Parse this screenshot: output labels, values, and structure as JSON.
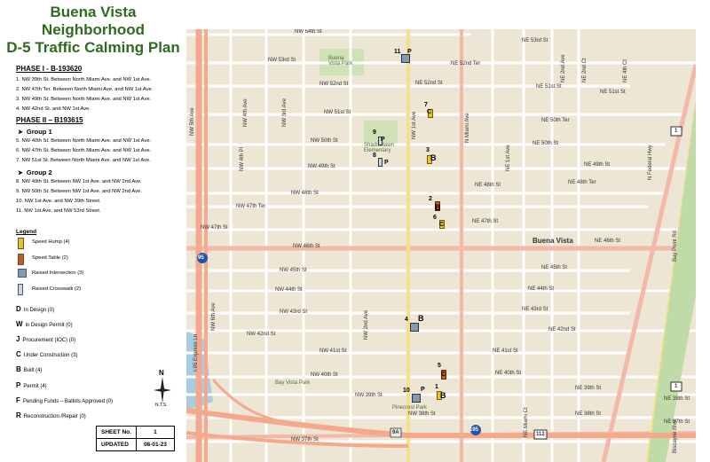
{
  "title": {
    "line1": "Buena Vista",
    "line2": "Neighborhood",
    "line3": "D-5 Traffic Calming Plan"
  },
  "phase1": {
    "heading": "PHASE I - B-193620",
    "items": [
      "1.   NW 39th St. Between North Miami Ave. and NW 1st Ave.",
      "2.   NW 47th Ter. Between North Miami Ave. and NW 1st Ave.",
      "3.   NW 49th St. Between North Miami Ave. and NW 1st Ave.",
      "4.   NW 42nd St. and NW 1st Ave."
    ]
  },
  "phase2": {
    "heading": "PHASE II – B193615",
    "group1": {
      "label": "Group 1",
      "items": [
        "5.   NW 40th St. Between North Miami Ave. and NW 1st Ave.",
        "6.   NW 47th St. Between North Miami Ave. and NW 1st Ave.",
        "7.   NW 51st St. Between North Miami Ave. and NW 1st Ave."
      ]
    },
    "group2": {
      "label": "Group 2",
      "items": [
        "8.   NW 49th St. Between NW 1st Ave. and NW 2nd Ave.",
        "9.   NW 50th St. Between NW 1st Ave. and NW 2nd Ave.",
        "10.  NW 1st Ave. and NW 39th Street.",
        "11.  NW 1st Ave. and NW 53rd Street."
      ]
    }
  },
  "legend": {
    "heading": "Legend",
    "entries": [
      {
        "label": "Speed Hump (4)",
        "color": "#e9c21f"
      },
      {
        "label": "Speed Table (2)",
        "color": "#c85a12"
      },
      {
        "label": "Raised Intersection (3)",
        "color": "#7f9bb5"
      },
      {
        "label": "Raised Crosswalk (2)",
        "color": "#c8d6ea"
      }
    ]
  },
  "status": [
    {
      "code": "D",
      "label": "In Design  (0)"
    },
    {
      "code": "W",
      "label": "in Design Permit  (0)"
    },
    {
      "code": "J",
      "label": "Procurement (IOC)  (0)"
    },
    {
      "code": "C",
      "label": "Under Construction   (3)"
    },
    {
      "code": "B",
      "label": "Built   (4)"
    },
    {
      "code": "P",
      "label": "Permit   (4)"
    },
    {
      "code": "F",
      "label": "Pending Funds – Ballots Approved (0)"
    },
    {
      "code": "R",
      "label": "Reconstruction /Repair (0)"
    }
  ],
  "north": {
    "letter": "N",
    "note": "N.T.S."
  },
  "sheet": {
    "label1": "SHEET No.",
    "value1": "1",
    "label2": "UPDATED",
    "value2": "08-01-23"
  },
  "map": {
    "area_label": "Buena Vista",
    "park1": "Buena Vista Park",
    "park2": "Bay Vista Park",
    "school": "Shadowlawn Elementary",
    "park3": "Pinecrest Park",
    "streets": [
      "NW 54th St",
      "NW 53rd St",
      "NW 52nd St",
      "NW 51st St",
      "NW 50th St",
      "NW 49th St",
      "NW 48th St",
      "NW 47th Ter",
      "NW 47th St",
      "NW 46th St",
      "NW 45th St",
      "NW 44th St",
      "NW 43rd St",
      "NW 42nd St",
      "NW 41st St",
      "NW 40th St",
      "NW 39th St",
      "NW 38th St",
      "NW 37th St",
      "NE 53rd St",
      "NE 52nd Ter",
      "NE 52nd St",
      "NE 51st St",
      "NE 50th Ter",
      "NE 50th St",
      "NE 49th St",
      "NE 48th St",
      "NE 47th St",
      "NE 46th St",
      "NE 45th St",
      "NE 44th St",
      "NE 43rd St",
      "NE 42nd St",
      "NE 41st St",
      "NE 40th St",
      "NE 39th St",
      "NE 38th St",
      "NE 37th St",
      "NE 48th Ter",
      "NE 51st St",
      "NE 38th St"
    ],
    "avenues": [
      "NW 5th Ave",
      "NW 4th Pl",
      "NW 4th Ave",
      "NW 3rd Ave",
      "NW 2nd Ave",
      "NW 1st Ave",
      "N Miami Ave",
      "NE 1st Ave",
      "NE 2nd Ave",
      "NE 2nd Ct",
      "NE 4th Ct",
      "N Federal Hwy",
      "Biscayne Blvd",
      "Bay Point Rd",
      "I-95 Express Ln",
      "NW 6th Ave",
      "NE Miami Ct"
    ],
    "shields": [
      "1",
      "95",
      "112",
      "195",
      "9A"
    ],
    "markers": [
      {
        "num": "11",
        "code": "P",
        "type": "raised-intersection"
      },
      {
        "num": "7",
        "code": "C",
        "type": "speed-hump"
      },
      {
        "num": "9",
        "code": "P",
        "type": "raised-crosswalk"
      },
      {
        "num": "8",
        "code": "P",
        "type": "raised-crosswalk"
      },
      {
        "num": "3",
        "code": "B",
        "type": "speed-hump"
      },
      {
        "num": "2",
        "code": "B",
        "type": "speed-table"
      },
      {
        "num": "6",
        "code": "C",
        "type": "speed-hump"
      },
      {
        "num": "4",
        "code": "B",
        "type": "raised-intersection"
      },
      {
        "num": "5",
        "code": "C",
        "type": "speed-table"
      },
      {
        "num": "10",
        "code": "P",
        "type": "raised-intersection"
      },
      {
        "num": "1",
        "code": "B",
        "type": "speed-hump"
      }
    ]
  }
}
